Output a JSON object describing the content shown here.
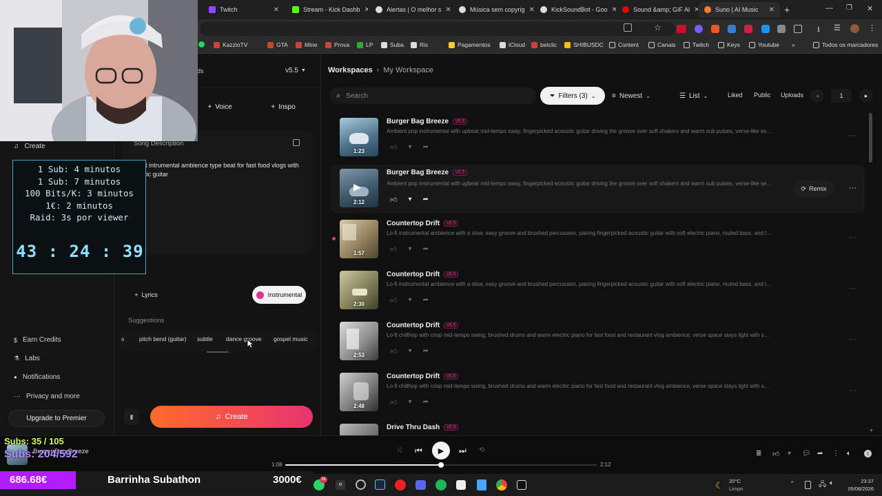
{
  "browser": {
    "tabs": [
      {
        "title": "Twitch",
        "color": "#9146ff"
      },
      {
        "title": "Stream - Kick Dashb",
        "color": "#53fc18"
      },
      {
        "title": "Alertas | O melhor s",
        "color": "#dddddd"
      },
      {
        "title": "Música sem copyrig",
        "color": "#dddddd"
      },
      {
        "title": "KickSoundBot - Goo",
        "color": "#dddddd"
      },
      {
        "title": "Sound &amp; GIF Al",
        "color": "#e00"
      },
      {
        "title": "Suno | AI Music",
        "color": "#ff7a29"
      }
    ],
    "bookmarks": [
      "KazzioTV",
      "GTA",
      "Mine",
      "Prova",
      "LP",
      "Suba",
      "Rix",
      "Pagamentos",
      "iCloud",
      "betclic",
      "SHIBUSDC",
      "Content",
      "Canais",
      "Twitch",
      "Keys",
      "Youtube",
      "Todos os marcadores"
    ]
  },
  "sidebar": {
    "create_label": "Create",
    "items": [
      {
        "label": "Earn Credits",
        "icon": "dollar-icon"
      },
      {
        "label": "Labs",
        "icon": "flask-icon"
      },
      {
        "label": "Notifications",
        "icon": "bell-icon"
      },
      {
        "label": "Privacy and more",
        "icon": "dots-icon"
      }
    ],
    "upgrade_label": "Upgrade to Premier"
  },
  "panel": {
    "partial_label": "ds",
    "version": "v5.5",
    "voice_label": "Voice",
    "inspo_label": "Inspo",
    "song_desc_label": "Song Description",
    "song_desc_text": "upbeat intrumental ambience type beat for fast food vlogs with acoustic guitar",
    "lyrics_label": "Lyrics",
    "instrumental_label": "Instrumental",
    "suggestions_label": "Suggestions",
    "suggestions": [
      "s",
      "pitch bend (guitar)",
      "subtle",
      "dance groove",
      "gospel music"
    ],
    "create_label": "Create"
  },
  "main": {
    "breadcrumb_root": "Workspaces",
    "breadcrumb_current": "My Workspace",
    "search_placeholder": "Search",
    "filters_label": "Filters (3)",
    "sort_label": "Newest",
    "view_label": "List",
    "liked": "Liked",
    "public": "Public",
    "uploads": "Uploads",
    "page": "1",
    "remix_label": "Remix",
    "songs": [
      {
        "title": "Burger Bag Breeze",
        "version": "v5.5",
        "duration": "1:23",
        "desc": "Ambient pop instrumental with upbeat mid-tempo sway, fingerpicked acoustic guitar driving the groove over soft shakers and warm sub pulses, verse-like sections st..."
      },
      {
        "title": "Burger Bag Breeze",
        "version": "v5.5",
        "duration": "2:12",
        "desc": "Ambient pop instrumental with upbeat mid-tempo sway, fingerpicked acoustic guitar driving the groove over soft shakers and warm sub pulses, verse-like sections st..."
      },
      {
        "title": "Countertop Drift",
        "version": "v5.5",
        "duration": "1:57",
        "desc": "Lo-fi instrumental ambience with a slow, easy groove and brushed percussion, pairing fingerpicked acoustic guitar with soft electric piano, muted bass, and tiny kitche..."
      },
      {
        "title": "Countertop Drift",
        "version": "v5.5",
        "duration": "2:30",
        "desc": "Lo-fi instrumental ambience with a slow, easy groove and brushed percussion, pairing fingerpicked acoustic guitar with soft electric piano, muted bass, and tiny kitche..."
      },
      {
        "title": "Countertop Drift",
        "version": "v5.5",
        "duration": "2:53",
        "desc": "Lo-fi chillhop with crisp mid-tempo swing, brushed drums and warm electric piano for fast food and restaurant vlog ambience, verse space stays light with soft bass a..."
      },
      {
        "title": "Countertop Drift",
        "version": "v5.5",
        "duration": "2:48",
        "desc": "Lo-fi chillhop with crisp mid-tempo swing, brushed drums and warm electric piano for fast food and restaurant vlog ambience, verse space stays light with soft bass a..."
      },
      {
        "title": "Drive Thru Dash",
        "version": "v5.5",
        "duration": "",
        "desc": ""
      }
    ]
  },
  "player": {
    "title": "Burger Bag Breeze",
    "elapsed": "1:08",
    "total": "2:12",
    "progress": 0.5
  },
  "overlay": {
    "subs_line1": "Subs: 35 / 105",
    "subs_line2": "Subs: 204/592",
    "amount": "686.68€",
    "bar_title": "Barrinha Subathon",
    "goal": "3000€",
    "timer_rules": [
      "1 Sub: 4 minutos",
      "1 Sub: 7 minutos",
      "100 Bits/K: 3 minutos",
      "1€: 2 minutos",
      "Raid: 3s por viewer"
    ],
    "timer": "43 : 24 : 39"
  },
  "taskbar": {
    "weather_temp": "20°C",
    "weather_desc": "Limpo",
    "time": "23:37",
    "date": "05/08/2026",
    "badge": "38"
  }
}
